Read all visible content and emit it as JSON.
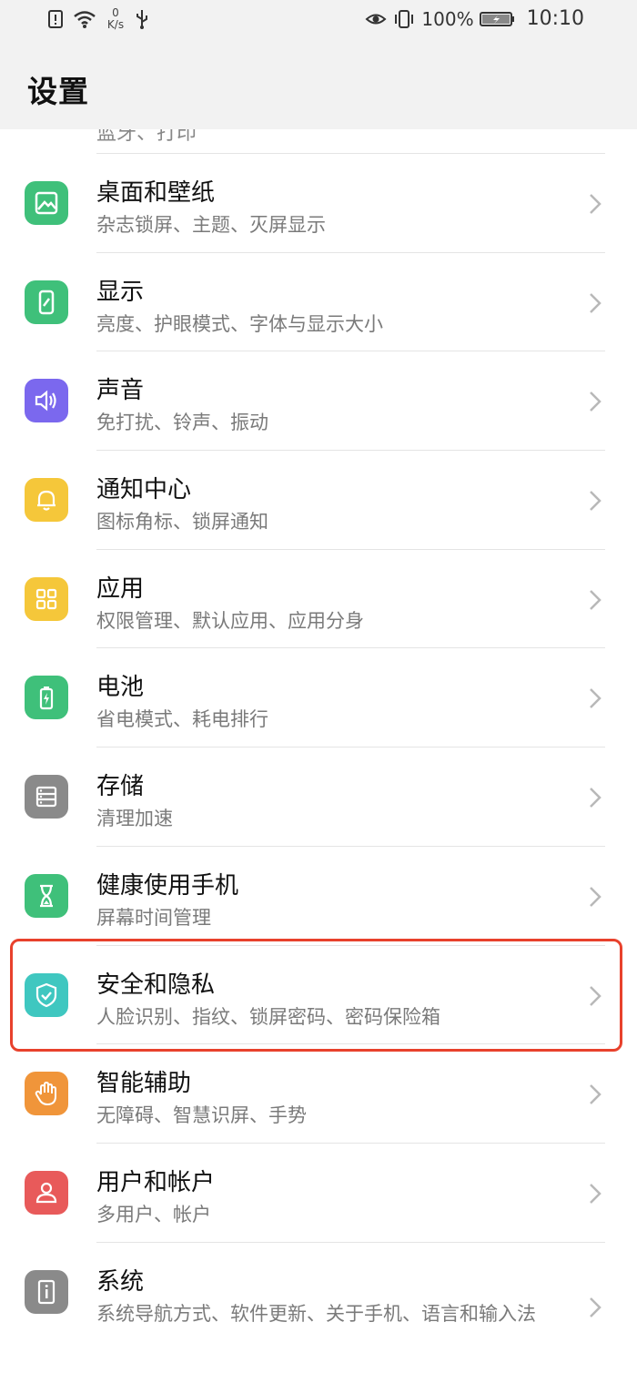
{
  "status_bar": {
    "speed_value": "0",
    "speed_unit": "K/s",
    "battery_percent": "100%",
    "time": "10:10"
  },
  "header": {
    "title": "设置"
  },
  "partial_item": {
    "subtitle": "蓝牙、打印"
  },
  "items": [
    {
      "label": "桌面和壁纸",
      "subtitle": "杂志锁屏、主题、灭屏显示",
      "icon": "wallpaper-icon",
      "color": "#3fc07a"
    },
    {
      "label": "显示",
      "subtitle": "亮度、护眼模式、字体与显示大小",
      "icon": "display-icon",
      "color": "#3fc07a"
    },
    {
      "label": "声音",
      "subtitle": "免打扰、铃声、振动",
      "icon": "sound-icon",
      "color": "#7b68ee"
    },
    {
      "label": "通知中心",
      "subtitle": "图标角标、锁屏通知",
      "icon": "bell-icon",
      "color": "#f5c73a"
    },
    {
      "label": "应用",
      "subtitle": "权限管理、默认应用、应用分身",
      "icon": "apps-icon",
      "color": "#f5c73a"
    },
    {
      "label": "电池",
      "subtitle": "省电模式、耗电排行",
      "icon": "battery-icon",
      "color": "#3fc07a"
    },
    {
      "label": "存储",
      "subtitle": "清理加速",
      "icon": "storage-icon",
      "color": "#8a8a8a"
    },
    {
      "label": "健康使用手机",
      "subtitle": "屏幕时间管理",
      "icon": "hourglass-icon",
      "color": "#3fc07a"
    },
    {
      "label": "安全和隐私",
      "subtitle": "人脸识别、指纹、锁屏密码、密码保险箱",
      "icon": "shield-icon",
      "color": "#3fc7c0"
    },
    {
      "label": "智能辅助",
      "subtitle": "无障碍、智慧识屏、手势",
      "icon": "hand-icon",
      "color": "#f0953a"
    },
    {
      "label": "用户和帐户",
      "subtitle": "多用户、帐户",
      "icon": "user-icon",
      "color": "#e85a5a"
    },
    {
      "label": "系统",
      "subtitle": "系统导航方式、软件更新、关于手机、语言和输入法",
      "icon": "system-info-icon",
      "color": "#8a8a8a"
    }
  ],
  "highlight_color": "#e8412c"
}
